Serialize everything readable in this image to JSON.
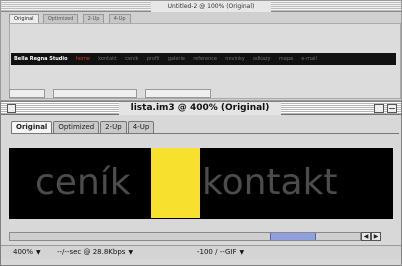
{
  "background_window": {
    "title": "Untitled-2 @ 100% (Original)",
    "tabs": [
      "Original",
      "Optimized",
      "2-Up",
      "4-Up"
    ],
    "strip_items": [
      {
        "label": "Bella Regna Studio",
        "kind": "brand"
      },
      {
        "label": "home",
        "kind": "highlight"
      },
      {
        "label": "kontakt",
        "kind": "normal"
      },
      {
        "label": "ceník",
        "kind": "normal"
      },
      {
        "label": "profil",
        "kind": "normal"
      },
      {
        "label": "galerie",
        "kind": "normal"
      },
      {
        "label": "reference",
        "kind": "normal"
      },
      {
        "label": "novinky",
        "kind": "normal"
      },
      {
        "label": "odkazy",
        "kind": "normal"
      },
      {
        "label": "mapa",
        "kind": "normal"
      },
      {
        "label": "e-mail",
        "kind": "normal"
      }
    ]
  },
  "main_window": {
    "title": "lista.im3 @ 400% (Original)",
    "tabs": [
      {
        "label": "Original",
        "active": true
      },
      {
        "label": "Optimized",
        "active": false
      },
      {
        "label": "2-Up",
        "active": false
      },
      {
        "label": "4-Up",
        "active": false
      }
    ],
    "canvas": {
      "left_text": "ceník",
      "right_text": "kontakt",
      "highlight_color": "#f7e02e",
      "text_color": "#4c4c4c"
    },
    "status": {
      "zoom": "400%",
      "download_info": "--/--sec @ 28.8Kbps",
      "color_info": "-100 / --GIF"
    }
  },
  "icons": {
    "dropdown": "▼",
    "scroll_left": "◀",
    "scroll_right": "▶"
  }
}
